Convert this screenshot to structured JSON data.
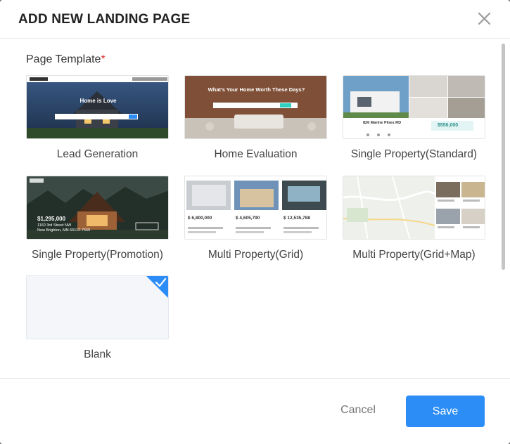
{
  "dialog": {
    "title": "ADD NEW LANDING PAGE",
    "close_icon": "close-icon"
  },
  "page_template": {
    "label": "Page Template",
    "required_marker": "*",
    "selected": "Blank",
    "templates": [
      {
        "label": "Lead Generation",
        "preview": {
          "headline": "Home is Love"
        }
      },
      {
        "label": "Home Evaluation",
        "preview": {
          "headline": "What's Your Home Worth These Days?"
        }
      },
      {
        "label": "Single Property(Standard)",
        "preview": {
          "address": "826 Marine Pines RD",
          "price": "$550,000"
        }
      },
      {
        "label": "Single Property(Promotion)",
        "preview": {
          "price": "$1,295,000",
          "address_line1": "1160 3rd Street NW",
          "address_line2": "New Brighton, MN 55112-7569"
        }
      },
      {
        "label": "Multi Property(Grid)",
        "preview": {
          "prices": [
            "$ 6,800,000",
            "$ 4,605,790",
            "$ 12,535,788"
          ]
        }
      },
      {
        "label": "Multi Property(Grid+Map)",
        "preview": {}
      },
      {
        "label": "Blank",
        "preview": {}
      }
    ]
  },
  "footer": {
    "cancel_label": "Cancel",
    "save_label": "Save"
  },
  "colors": {
    "accent": "#2c8df7",
    "required": "#e03131"
  }
}
